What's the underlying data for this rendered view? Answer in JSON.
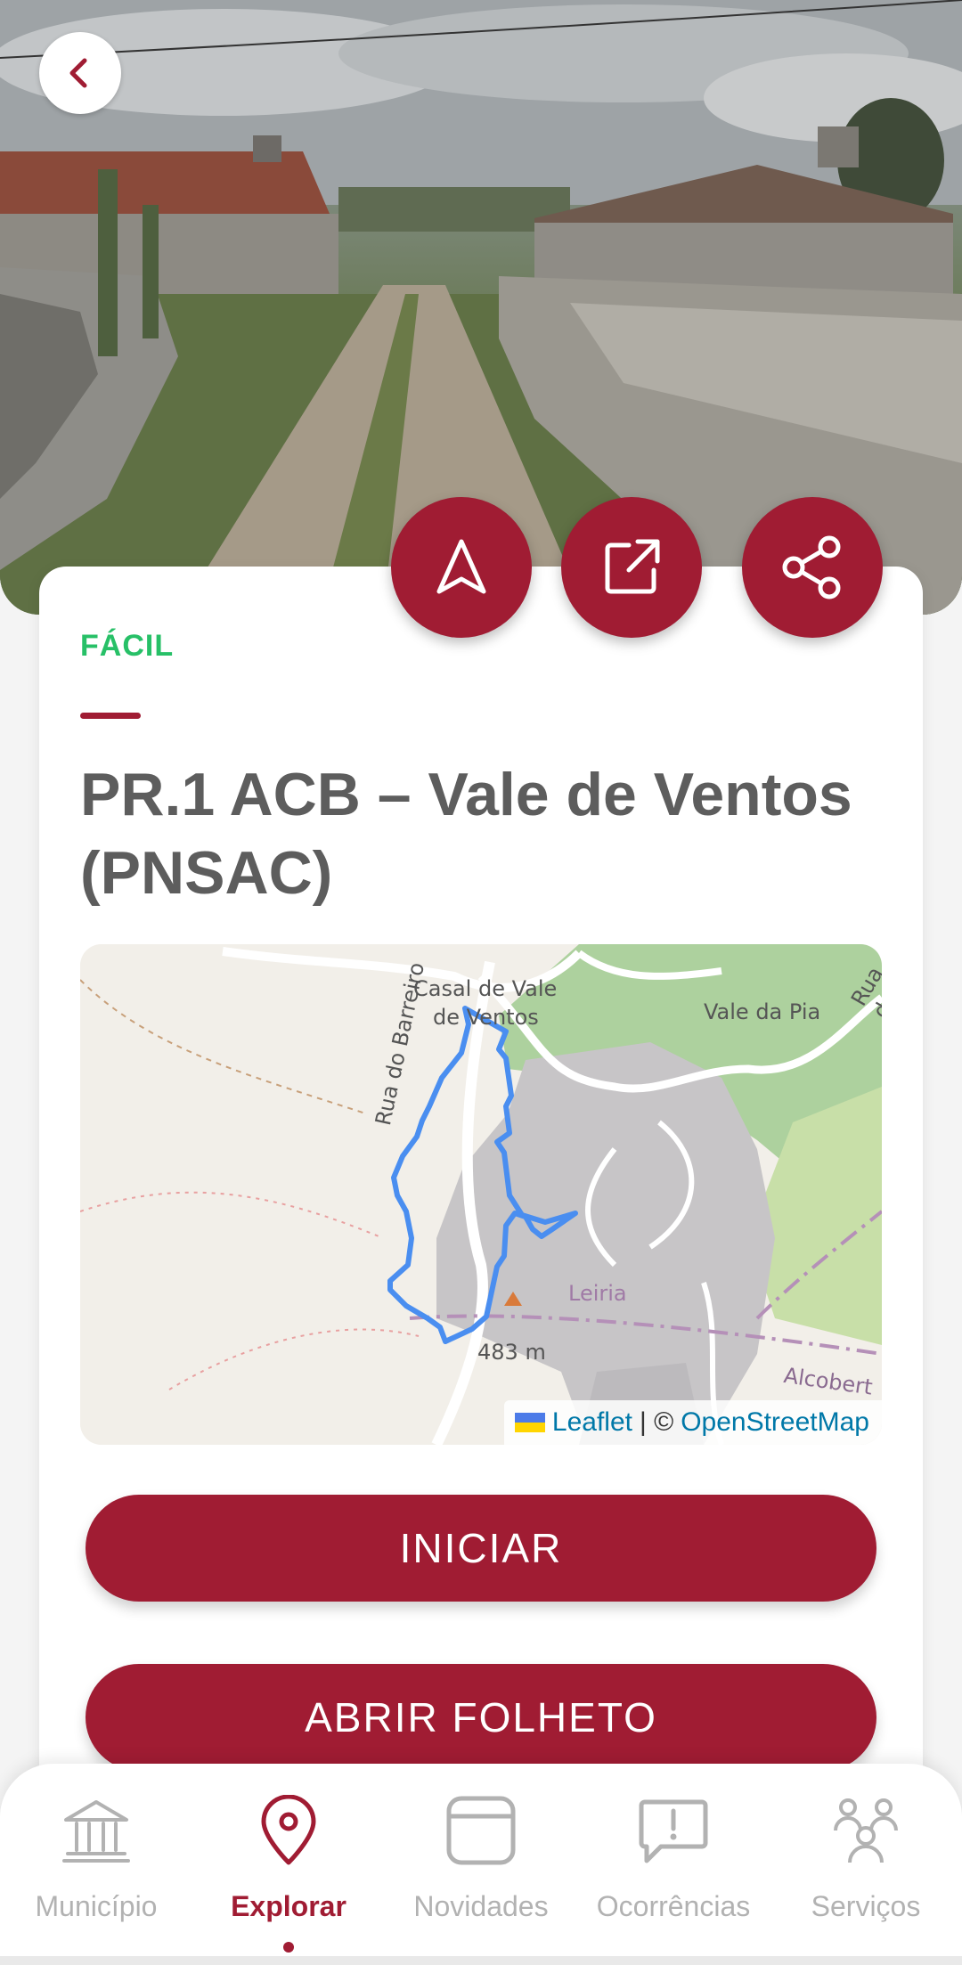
{
  "route": {
    "difficulty": "FÁCIL",
    "title": "PR.1 ACB – Vale de Ventos (PNSAC)"
  },
  "hero": {
    "image_alt": "Rural dirt path between stone walls and old stone houses"
  },
  "actions": {
    "back_icon": "chevron-left-icon",
    "navigate_icon": "navigation-arrow-icon",
    "open_external_icon": "external-link-icon",
    "share_icon": "share-icon"
  },
  "map": {
    "labels": {
      "place1_line1": "Casal de Vale",
      "place1_line2": "de Ventos",
      "place2": "Vale da Pia",
      "street1": "Rua do Barreiro",
      "street2": "Rua d",
      "region": "Leiria",
      "elevation": "483 m",
      "town": "Alcobert"
    },
    "attribution": {
      "leaflet": "Leaflet",
      "separator": "| ©",
      "osm": "OpenStreetMap"
    }
  },
  "buttons": {
    "start": "INICIAR",
    "open_leaflet": "ABRIR FOLHETO"
  },
  "nav": {
    "items": [
      {
        "label": "Município",
        "icon": "building-columns-icon",
        "active": false
      },
      {
        "label": "Explorar",
        "icon": "map-pin-icon",
        "active": true
      },
      {
        "label": "Novidades",
        "icon": "news-card-icon",
        "active": false
      },
      {
        "label": "Ocorrências",
        "icon": "alert-chat-icon",
        "active": false
      },
      {
        "label": "Serviços",
        "icon": "people-icon",
        "active": false
      }
    ]
  },
  "colors": {
    "accent": "#a01c33",
    "difficulty_green": "#27c067",
    "title_gray": "#5d5d5d",
    "route_blue": "#3388ff",
    "inactive_gray": "#b2b2b2"
  }
}
